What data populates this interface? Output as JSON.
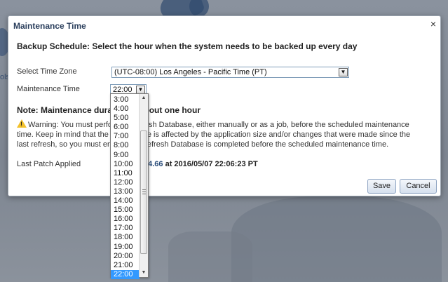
{
  "dialog": {
    "title": "Maintenance Time",
    "close_glyph": "×",
    "heading": "Backup Schedule: Select the hour when the system needs to be backed up every day"
  },
  "form": {
    "time_zone_label": "Select Time Zone",
    "time_zone_value": "(UTC-08:00) Los Angeles - Pacific Time (PT)",
    "maintenance_time_label": "Maintenance Time",
    "maintenance_time_value": "22:00",
    "last_patch_label": "Last Patch Applied"
  },
  "note": {
    "title": "Note: Maintenance duration is about one hour",
    "warning_icon": "warning-icon",
    "text": "Warning: You must perform a Refresh Database, either manually or as a job, before the scheduled maintenance time. Keep in mind that the refresh time is affected by the application size and/or changes that were made since the last refresh, so you must ensure the Refresh Database is completed before the scheduled maintenance time."
  },
  "patch": {
    "version": "04.66",
    "suffix": " at 2016/05/07 22:06:23 PT"
  },
  "buttons": {
    "save": "Save",
    "cancel": "Cancel"
  },
  "dropdown": {
    "options": [
      "3:00",
      "4:00",
      "5:00",
      "6:00",
      "7:00",
      "8:00",
      "9:00",
      "10:00",
      "11:00",
      "12:00",
      "13:00",
      "14:00",
      "15:00",
      "16:00",
      "17:00",
      "18:00",
      "19:00",
      "20:00",
      "21:00",
      "22:00"
    ],
    "selected": "22:00",
    "scroll_up_glyph": "▲",
    "scroll_down_glyph": "▼"
  },
  "background": {
    "fragment_text": "ols"
  },
  "colors": {
    "title_text": "#2a3e5c",
    "selected_option": "#3399ff",
    "warning": "#f3c12b",
    "overlay": "#7c8491"
  }
}
